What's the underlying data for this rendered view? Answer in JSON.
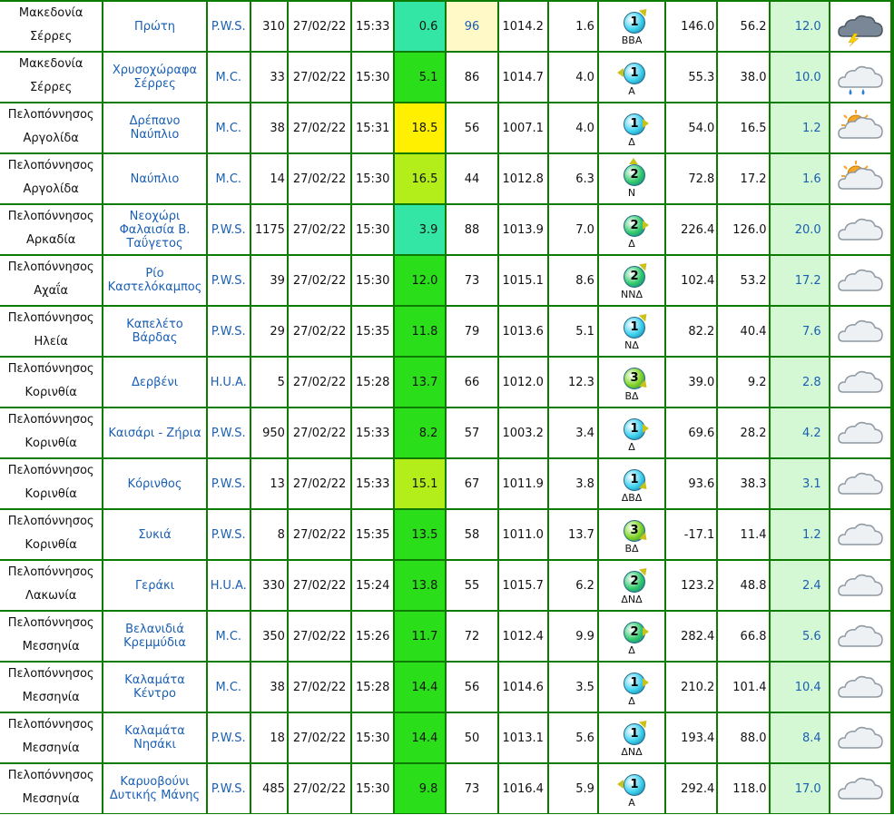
{
  "rows": [
    {
      "region": "Μακεδονία",
      "area": "Σέρρες",
      "station": "Πρώτη",
      "type": "P.W.S.",
      "alt": "310",
      "date": "27/02/22",
      "time": "15:33",
      "temp": "0.6",
      "temp_color": "#33e6a6",
      "hum": "96",
      "hum_bg": "#fff9c8",
      "pres": "1014.2",
      "rain": "1.6",
      "wind_force": "1",
      "wind_ball": "#3fd0f0",
      "wind_dir": "ΒΒΑ",
      "arrow": "ne",
      "rad": "146.0",
      "uv": "56.2",
      "gust": "12.0",
      "weather": "storm-icon"
    },
    {
      "region": "Μακεδονία",
      "area": "Σέρρες",
      "station": "Χρυσοχώραφα Σέρρες",
      "type": "M.C.",
      "alt": "33",
      "date": "27/02/22",
      "time": "15:30",
      "temp": "5.1",
      "temp_color": "#2adf1a",
      "hum": "86",
      "hum_bg": "#ffffff",
      "pres": "1014.7",
      "rain": "4.0",
      "wind_force": "1",
      "wind_ball": "#3fd0f0",
      "wind_dir": "Α",
      "arrow": "w",
      "rad": "55.3",
      "uv": "38.0",
      "gust": "10.0",
      "weather": "rain-cloud-icon"
    },
    {
      "region": "Πελοπόννησος",
      "area": "Αργολίδα",
      "station": "Δρέπανο Ναύπλιο",
      "type": "M.C.",
      "alt": "38",
      "date": "27/02/22",
      "time": "15:31",
      "temp": "18.5",
      "temp_color": "#fff000",
      "hum": "56",
      "hum_bg": "#ffffff",
      "pres": "1007.1",
      "rain": "4.0",
      "wind_force": "1",
      "wind_ball": "#3fd0f0",
      "wind_dir": "Δ",
      "arrow": "e",
      "rad": "54.0",
      "uv": "16.5",
      "gust": "1.2",
      "weather": "sun-cloud-icon"
    },
    {
      "region": "Πελοπόννησος",
      "area": "Αργολίδα",
      "station": "Ναύπλιο",
      "type": "M.C.",
      "alt": "14",
      "date": "27/02/22",
      "time": "15:30",
      "temp": "16.5",
      "temp_color": "#b3ee1a",
      "hum": "44",
      "hum_bg": "#ffffff",
      "pres": "1012.8",
      "rain": "6.3",
      "wind_force": "2",
      "wind_ball": "#2fc86a",
      "wind_dir": "Ν",
      "arrow": "n",
      "rad": "72.8",
      "uv": "17.2",
      "gust": "1.6",
      "weather": "sun-cloud-icon"
    },
    {
      "region": "Πελοπόννησος",
      "area": "Αρκαδία",
      "station": "Νεοχώρι Φαλαισία Β. Ταΰγετος",
      "type": "P.W.S.",
      "alt": "1175",
      "date": "27/02/22",
      "time": "15:30",
      "temp": "3.9",
      "temp_color": "#33e6a6",
      "hum": "88",
      "hum_bg": "#ffffff",
      "pres": "1013.9",
      "rain": "7.0",
      "wind_force": "2",
      "wind_ball": "#2fc86a",
      "wind_dir": "Δ",
      "arrow": "e",
      "rad": "226.4",
      "uv": "126.0",
      "gust": "20.0",
      "weather": "cloud-icon"
    },
    {
      "region": "Πελοπόννησος",
      "area": "Αχαΐα",
      "station": "Ρίο Καστελόκαμπος",
      "type": "P.W.S.",
      "alt": "39",
      "date": "27/02/22",
      "time": "15:30",
      "temp": "12.0",
      "temp_color": "#2adf1a",
      "hum": "73",
      "hum_bg": "#ffffff",
      "pres": "1015.1",
      "rain": "8.6",
      "wind_force": "2",
      "wind_ball": "#2fc86a",
      "wind_dir": "ΝΝΔ",
      "arrow": "ne",
      "rad": "102.4",
      "uv": "53.2",
      "gust": "17.2",
      "weather": "cloud-icon"
    },
    {
      "region": "Πελοπόννησος",
      "area": "Ηλεία",
      "station": "Καπελέτο Βάρδας",
      "type": "P.W.S.",
      "alt": "29",
      "date": "27/02/22",
      "time": "15:35",
      "temp": "11.8",
      "temp_color": "#2adf1a",
      "hum": "79",
      "hum_bg": "#ffffff",
      "pres": "1013.6",
      "rain": "5.1",
      "wind_force": "1",
      "wind_ball": "#3fd0f0",
      "wind_dir": "ΝΔ",
      "arrow": "ne",
      "rad": "82.2",
      "uv": "40.4",
      "gust": "7.6",
      "weather": "cloud-icon"
    },
    {
      "region": "Πελοπόννησος",
      "area": "Κορινθία",
      "station": "Δερβένι",
      "type": "H.U.A.",
      "alt": "5",
      "date": "27/02/22",
      "time": "15:28",
      "temp": "13.7",
      "temp_color": "#2adf1a",
      "hum": "66",
      "hum_bg": "#ffffff",
      "pres": "1012.0",
      "rain": "12.3",
      "wind_force": "3",
      "wind_ball": "#7ed321",
      "wind_dir": "ΒΔ",
      "arrow": "se",
      "rad": "39.0",
      "uv": "9.2",
      "gust": "2.8",
      "weather": "cloud-icon"
    },
    {
      "region": "Πελοπόννησος",
      "area": "Κορινθία",
      "station": "Καισάρι - Ζήρια",
      "type": "P.W.S.",
      "alt": "950",
      "date": "27/02/22",
      "time": "15:33",
      "temp": "8.2",
      "temp_color": "#2adf1a",
      "hum": "57",
      "hum_bg": "#ffffff",
      "pres": "1003.2",
      "rain": "3.4",
      "wind_force": "1",
      "wind_ball": "#3fd0f0",
      "wind_dir": "Δ",
      "arrow": "e",
      "rad": "69.6",
      "uv": "28.2",
      "gust": "4.2",
      "weather": "cloud-icon"
    },
    {
      "region": "Πελοπόννησος",
      "area": "Κορινθία",
      "station": "Κόρινθος",
      "type": "P.W.S.",
      "alt": "13",
      "date": "27/02/22",
      "time": "15:33",
      "temp": "15.1",
      "temp_color": "#b3ee1a",
      "hum": "67",
      "hum_bg": "#ffffff",
      "pres": "1011.9",
      "rain": "3.8",
      "wind_force": "1",
      "wind_ball": "#3fd0f0",
      "wind_dir": "ΔΒΔ",
      "arrow": "se",
      "rad": "93.6",
      "uv": "38.3",
      "gust": "3.1",
      "weather": "cloud-icon"
    },
    {
      "region": "Πελοπόννησος",
      "area": "Κορινθία",
      "station": "Συκιά",
      "type": "P.W.S.",
      "alt": "8",
      "date": "27/02/22",
      "time": "15:35",
      "temp": "13.5",
      "temp_color": "#2adf1a",
      "hum": "58",
      "hum_bg": "#ffffff",
      "pres": "1011.0",
      "rain": "13.7",
      "wind_force": "3",
      "wind_ball": "#7ed321",
      "wind_dir": "ΒΔ",
      "arrow": "se",
      "rad": "-17.1",
      "uv": "11.4",
      "gust": "1.2",
      "weather": "cloud-icon"
    },
    {
      "region": "Πελοπόννησος",
      "area": "Λακωνία",
      "station": "Γεράκι",
      "type": "H.U.A.",
      "alt": "330",
      "date": "27/02/22",
      "time": "15:24",
      "temp": "13.8",
      "temp_color": "#2adf1a",
      "hum": "55",
      "hum_bg": "#ffffff",
      "pres": "1015.7",
      "rain": "6.2",
      "wind_force": "2",
      "wind_ball": "#2fc86a",
      "wind_dir": "ΔΝΔ",
      "arrow": "ne",
      "rad": "123.2",
      "uv": "48.8",
      "gust": "2.4",
      "weather": "cloud-icon"
    },
    {
      "region": "Πελοπόννησος",
      "area": "Μεσσηνία",
      "station": "Βελανιδιά Κρεμμύδια",
      "type": "M.C.",
      "alt": "350",
      "date": "27/02/22",
      "time": "15:26",
      "temp": "11.7",
      "temp_color": "#2adf1a",
      "hum": "72",
      "hum_bg": "#ffffff",
      "pres": "1012.4",
      "rain": "9.9",
      "wind_force": "2",
      "wind_ball": "#2fc86a",
      "wind_dir": "Δ",
      "arrow": "e",
      "rad": "282.4",
      "uv": "66.8",
      "gust": "5.6",
      "weather": "cloud-icon"
    },
    {
      "region": "Πελοπόννησος",
      "area": "Μεσσηνία",
      "station": "Καλαμάτα Κέντρο",
      "type": "M.C.",
      "alt": "38",
      "date": "27/02/22",
      "time": "15:28",
      "temp": "14.4",
      "temp_color": "#2adf1a",
      "hum": "56",
      "hum_bg": "#ffffff",
      "pres": "1014.6",
      "rain": "3.5",
      "wind_force": "1",
      "wind_ball": "#3fd0f0",
      "wind_dir": "Δ",
      "arrow": "e",
      "rad": "210.2",
      "uv": "101.4",
      "gust": "10.4",
      "weather": "cloud-icon"
    },
    {
      "region": "Πελοπόννησος",
      "area": "Μεσσηνία",
      "station": "Καλαμάτα Νησάκι",
      "type": "P.W.S.",
      "alt": "18",
      "date": "27/02/22",
      "time": "15:30",
      "temp": "14.4",
      "temp_color": "#2adf1a",
      "hum": "50",
      "hum_bg": "#ffffff",
      "pres": "1013.1",
      "rain": "5.6",
      "wind_force": "1",
      "wind_ball": "#3fd0f0",
      "wind_dir": "ΔΝΔ",
      "arrow": "ne",
      "rad": "193.4",
      "uv": "88.0",
      "gust": "8.4",
      "weather": "cloud-icon"
    },
    {
      "region": "Πελοπόννησος",
      "area": "Μεσσηνία",
      "station": "Καρυοβούνι Δυτικής Μάνης",
      "type": "P.W.S.",
      "alt": "485",
      "date": "27/02/22",
      "time": "15:30",
      "temp": "9.8",
      "temp_color": "#2adf1a",
      "hum": "73",
      "hum_bg": "#ffffff",
      "pres": "1016.4",
      "rain": "5.9",
      "wind_force": "1",
      "wind_ball": "#3fd0f0",
      "wind_dir": "Α",
      "arrow": "w",
      "rad": "292.4",
      "uv": "118.0",
      "gust": "17.0",
      "weather": "cloud-icon"
    }
  ]
}
